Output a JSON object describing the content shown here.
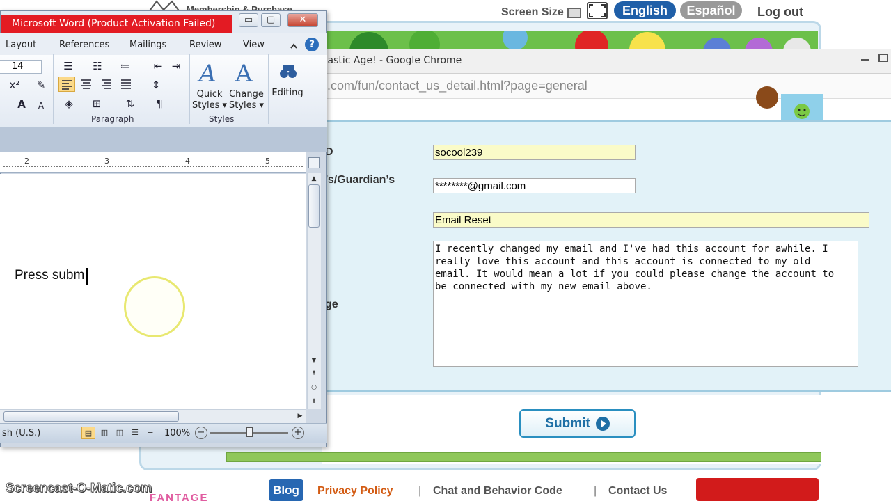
{
  "site": {
    "logo_text": "Membership & Purchase",
    "screen_size_label": "Screen Size",
    "lang_english": "English",
    "lang_espanol": "Español",
    "logout": "Log out"
  },
  "chrome": {
    "title": "tastic Age! - Google Chrome",
    "url_host": ".com",
    "url_path": "/fun/contact_us_detail.html?page=general"
  },
  "form": {
    "label_id": "D",
    "label_email": "’s/Guardian’s",
    "label_message": "ge",
    "username_value": "socool239",
    "email_value": "********@gmail.com",
    "subject_value": "Email Reset",
    "message_value": "I recently changed my email and I've had this account for awhile. I\nreally love this account and this account is connected to my old\nemail. It would mean a lot if you could please change the account to\nbe connected with my new email above.",
    "submit_label": "Submit"
  },
  "footer": {
    "screencast": "Screencast-O-Matic.com",
    "blog": "Blog",
    "privacy": "Privacy Policy",
    "sep1": "|",
    "chat": "Chat and Behavior Code",
    "sep2": "|",
    "contact": "Contact Us",
    "brand": "FANTAGE"
  },
  "word": {
    "title": "Microsoft Word (Product Activation Failed)",
    "min": "▭",
    "max": "▢",
    "close": "✕",
    "tabs": [
      "Layout",
      "References",
      "Mailings",
      "Review",
      "View"
    ],
    "help": "?",
    "font_size": "14",
    "superscript": "x²",
    "grow_font": "A",
    "shrink_font": "A",
    "pilcrow": "¶",
    "quick_styles": "Quick",
    "quick_styles2": "Styles ▾",
    "change_styles": "Change",
    "change_styles2": "Styles ▾",
    "editing": "Editing",
    "group_paragraph": "Paragraph",
    "group_styles": "Styles",
    "ruler_numbers": [
      "2",
      "3",
      "4",
      "5"
    ],
    "doc_text": "Press subm",
    "status_lang": "sh (U.S.)",
    "zoom": "100%",
    "zoom_out": "−",
    "zoom_in": "+"
  },
  "colors": {
    "word_title_red": "#e31b23",
    "site_blue": "#1f5fa8",
    "form_panel_bg": "#e2f2f8",
    "field_highlight": "#fafbc8",
    "privacy_orange": "#d35c14"
  }
}
